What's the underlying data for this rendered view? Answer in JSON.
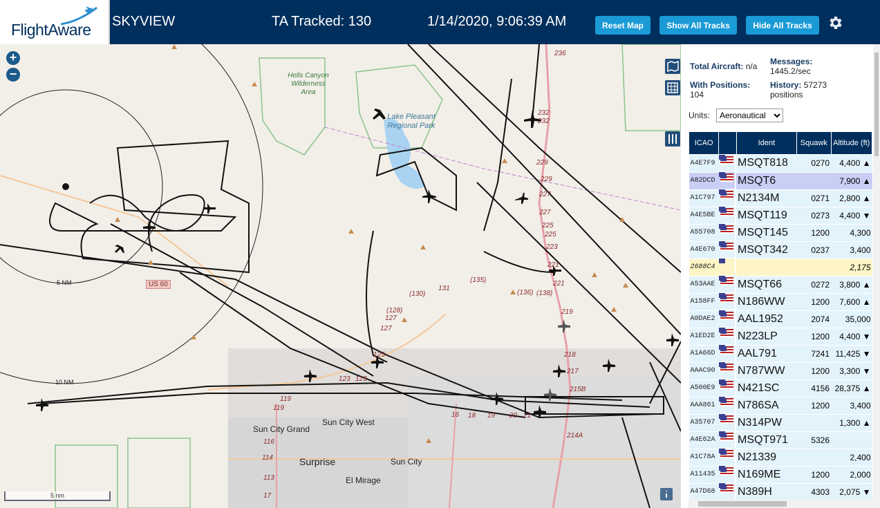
{
  "header": {
    "logo_text": "FlightAware",
    "app_title": "SKYVIEW",
    "tracked": "TA Tracked: 130",
    "clock": "1/14/2020, 9:06:39 AM",
    "buttons": {
      "reset": "Reset Map",
      "show_all": "Show All Tracks",
      "hide_all": "Hide All Tracks"
    },
    "settings_icon": "gear-icon"
  },
  "map": {
    "zoom_in": "+",
    "zoom_out": "−",
    "places": {
      "hells_canyon": "Hells Canyon Wilderness Area",
      "lake_pleasant": "Lake Pleasant Regional Park",
      "us60": "US 60",
      "sun_city_west": "Sun City West",
      "sun_city_grand": "Sun City Grand",
      "surprise": "Surprise",
      "sun_city": "Sun City",
      "el_mirage": "El Mirage"
    },
    "rings": {
      "r5": "5 NM",
      "r10": "10 NM"
    },
    "scale": "5 nm",
    "route_labels": [
      "236",
      "232",
      "232",
      "229",
      "229",
      "227",
      "227",
      "225",
      "225",
      "223",
      "221",
      "221",
      "219",
      "218",
      "217",
      "215B",
      "(135)",
      "(136)",
      "(138)",
      "(130)",
      "131",
      "(128)",
      "127",
      "127",
      "125",
      "123",
      "123",
      "119",
      "119",
      "116",
      "114",
      "113",
      "17",
      "16",
      "18",
      "19",
      "20",
      "21",
      "214A"
    ]
  },
  "panel": {
    "total_aircraft_label": "Total Aircraft:",
    "total_aircraft_value": "n/a",
    "messages_label": "Messages:",
    "messages_value": "1445.2/sec",
    "with_positions_label": "With Positions:",
    "with_positions_value": "104",
    "history_label": "History:",
    "history_value": "57273 positions",
    "units_label": "Units:",
    "units_value": "Aeronautical",
    "columns": [
      "ICAO",
      "",
      "Ident",
      "Squawk",
      "Altitude (ft)"
    ],
    "rows": [
      {
        "icao": "A4E7F9",
        "ident": "MSQT818",
        "squawk": "0270",
        "alt": "4,400 ▲"
      },
      {
        "icao": "A82DCD",
        "ident": "MSQT6",
        "squawk": "",
        "alt": "7,900 ▲"
      },
      {
        "icao": "A1C797",
        "ident": "N2134M",
        "squawk": "0271",
        "alt": "2,800 ▲"
      },
      {
        "icao": "A4E5BE",
        "ident": "MSQT119",
        "squawk": "0273",
        "alt": "4,400 ▼"
      },
      {
        "icao": "A55708",
        "ident": "MSQT145",
        "squawk": "1200",
        "alt": "4,300"
      },
      {
        "icao": "A4E670",
        "ident": "MSQT342",
        "squawk": "0237",
        "alt": "3,400"
      },
      {
        "icao": "2688C4",
        "ident": "",
        "squawk": "",
        "alt": "2,175"
      },
      {
        "icao": "A53AAE",
        "ident": "MSQT66",
        "squawk": "0272",
        "alt": "3,800 ▲"
      },
      {
        "icao": "A158FF",
        "ident": "N186WW",
        "squawk": "1200",
        "alt": "7,600 ▲"
      },
      {
        "icao": "A0DAE2",
        "ident": "AAL1952",
        "squawk": "2074",
        "alt": "35,000"
      },
      {
        "icao": "A1ED2E",
        "ident": "N223LP",
        "squawk": "1200",
        "alt": "4,400 ▼"
      },
      {
        "icao": "A1A66D",
        "ident": "AAL791",
        "squawk": "7241",
        "alt": "11,425 ▼"
      },
      {
        "icao": "AAAC90",
        "ident": "N787WW",
        "squawk": "1200",
        "alt": "3,300 ▼"
      },
      {
        "icao": "A500E9",
        "ident": "N421SC",
        "squawk": "4156",
        "alt": "28,375 ▲"
      },
      {
        "icao": "AAA861",
        "ident": "N786SA",
        "squawk": "1200",
        "alt": "3,400"
      },
      {
        "icao": "A35707",
        "ident": "N314PW",
        "squawk": "",
        "alt": "1,300 ▲"
      },
      {
        "icao": "A4E62A",
        "ident": "MSQT971",
        "squawk": "5326",
        "alt": ""
      },
      {
        "icao": "A1C78A",
        "ident": "N21339",
        "squawk": "",
        "alt": "2,400"
      },
      {
        "icao": "A11435",
        "ident": "N169ME",
        "squawk": "1200",
        "alt": "2,000"
      },
      {
        "icao": "A47D68",
        "ident": "N389H",
        "squawk": "4303",
        "alt": "2,075 ▼"
      }
    ]
  },
  "colors": {
    "header": "#002f5d",
    "button": "#1a9ad6",
    "row": "#e3f3fb",
    "selected": "#c9cef5",
    "highlight": "#fdf5c5"
  }
}
